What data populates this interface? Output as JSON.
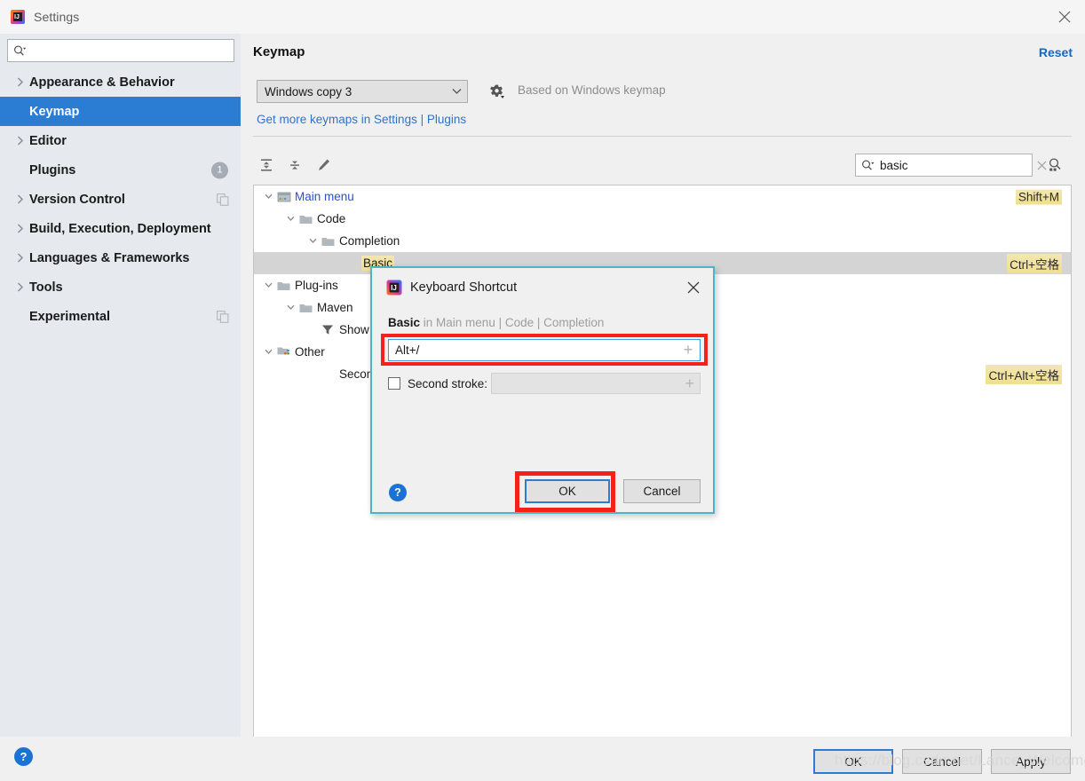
{
  "window": {
    "title": "Settings",
    "icon": "intellij-idea-icon",
    "close_icon": "close-icon"
  },
  "sidebar": {
    "search": {
      "value": "",
      "placeholder": "",
      "icon": "search-icon"
    },
    "items": [
      {
        "label": "Appearance & Behavior",
        "expandable": true,
        "selected": false
      },
      {
        "label": "Keymap",
        "expandable": false,
        "selected": true
      },
      {
        "label": "Editor",
        "expandable": true,
        "selected": false
      },
      {
        "label": "Plugins",
        "expandable": false,
        "selected": false,
        "badge": "1"
      },
      {
        "label": "Version Control",
        "expandable": true,
        "selected": false,
        "copy_badge": true
      },
      {
        "label": "Build, Execution, Deployment",
        "expandable": true,
        "selected": false
      },
      {
        "label": "Languages & Frameworks",
        "expandable": true,
        "selected": false
      },
      {
        "label": "Tools",
        "expandable": true,
        "selected": false
      },
      {
        "label": "Experimental",
        "expandable": false,
        "selected": false,
        "copy_badge": true
      }
    ]
  },
  "main": {
    "title": "Keymap",
    "reset_label": "Reset",
    "keymap_select": {
      "value": "Windows copy 3",
      "icon": "chevron-down-icon"
    },
    "gear_icon": "gear-icon",
    "based_on": "Based on Windows keymap",
    "more_keymaps_link": "Get more keymaps in Settings | Plugins",
    "toolbar": {
      "expand_all_icon": "expand-all-icon",
      "collapse_all_icon": "collapse-all-icon",
      "edit_icon": "pencil-edit-icon",
      "find_shortcut_icon": "find-by-shortcut-icon"
    },
    "search": {
      "value": "basic",
      "placeholder": "",
      "icon": "search-icon",
      "clear_icon": "clear-icon"
    },
    "tree": [
      {
        "depth": 0,
        "label": "Main menu",
        "twisty": "expanded",
        "icon": "main-menu-icon",
        "link": true,
        "shortcut": "Shift+M",
        "selected": false
      },
      {
        "depth": 1,
        "label": "Code",
        "twisty": "expanded",
        "icon": "folder-icon",
        "link": false,
        "shortcut": "",
        "selected": false
      },
      {
        "depth": 2,
        "label": "Completion",
        "twisty": "expanded",
        "icon": "folder-icon",
        "link": false,
        "shortcut": "",
        "selected": false
      },
      {
        "depth": 3,
        "label": "Basic",
        "twisty": "none",
        "icon": "action-icon",
        "link": false,
        "shortcut": "Ctrl+空格",
        "selected": true,
        "highlight": true
      },
      {
        "depth": 0,
        "label": "Plug-ins",
        "twisty": "expanded",
        "icon": "folder-icon",
        "link": false,
        "shortcut": "",
        "selected": false
      },
      {
        "depth": 1,
        "label": "Maven",
        "twisty": "expanded",
        "icon": "folder-icon",
        "link": false,
        "shortcut": "",
        "selected": false
      },
      {
        "depth": 2,
        "label": "Show Basic Phases Only",
        "twisty": "none",
        "icon": "filter-icon",
        "link": false,
        "shortcut": "",
        "selected": false
      },
      {
        "depth": 0,
        "label": "Other",
        "twisty": "expanded",
        "icon": "other-icon",
        "link": false,
        "shortcut": "",
        "selected": false
      },
      {
        "depth": 1,
        "label": "Second Basic Completion",
        "twisty": "none",
        "icon": "action-icon",
        "link": false,
        "shortcut": "Ctrl+Alt+空格",
        "selected": false
      }
    ]
  },
  "modal": {
    "title": "Keyboard Shortcut",
    "icon": "intellij-idea-icon",
    "close_icon": "close-icon",
    "subject": "Basic",
    "context": " in Main menu | Code | Completion",
    "first_stroke": {
      "value": "Alt+/",
      "add_icon": "plus-icon"
    },
    "second_stroke": {
      "label": "Second stroke:",
      "checked": false,
      "value": "",
      "add_icon": "plus-icon"
    },
    "help_label": "?",
    "ok_label": "OK",
    "cancel_label": "Cancel"
  },
  "footer": {
    "help_label": "?",
    "ok_label": "OK",
    "cancel_label": "Cancel",
    "apply_label": "Apply",
    "watermark": "https://blog.csdn.net/Lance_Welcome"
  },
  "colors": {
    "accent_blue": "#2b7cd3",
    "link_blue": "#1169c7",
    "highlight_yellow": "#efe08c",
    "annotation_red": "#f5211b",
    "modal_border": "#4cb4c4"
  }
}
